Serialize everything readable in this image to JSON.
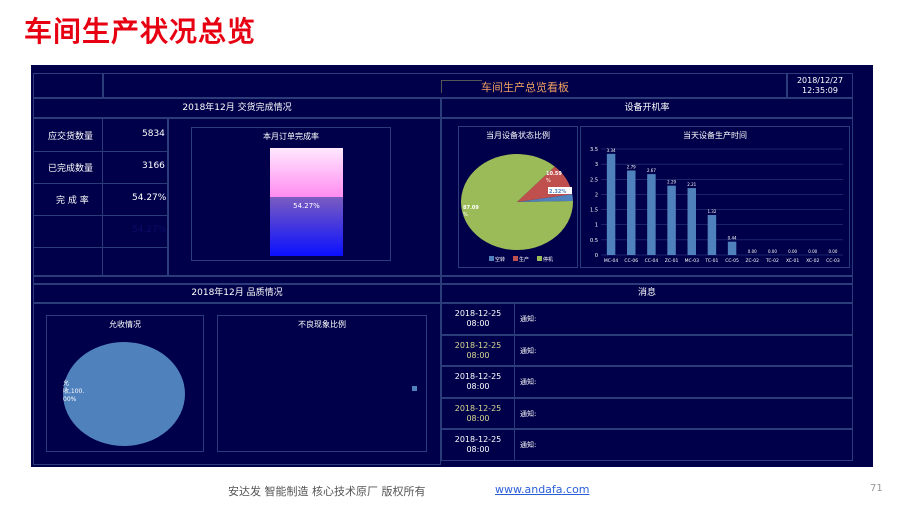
{
  "slide": {
    "title": "车间生产状况总览",
    "page_number": "71"
  },
  "board": {
    "title": "车间生产总览看板",
    "date": "2018/12/27",
    "time": "12:35:09"
  },
  "delivery": {
    "header": "2018年12月 交货完成情况",
    "rows": [
      {
        "label": "应交货数量",
        "value": "5834"
      },
      {
        "label": "已完成数量",
        "value": "3166"
      },
      {
        "label": "完 成 率",
        "value": "54.27%"
      },
      {
        "label": "",
        "value": "54.27%"
      }
    ],
    "order_chart": {
      "title": "本月订单完成率",
      "value_label": "54.27%",
      "fraction": 0.5427
    }
  },
  "equipment": {
    "header": "设备开机率",
    "pie": {
      "title": "当月设备状态比例",
      "slices": [
        {
          "name": "空转",
          "value": 2.32,
          "label": "2.32%",
          "color": "#4f81bd"
        },
        {
          "name": "生产",
          "value": 10.59,
          "label": "10.59 %",
          "color": "#c0504d"
        },
        {
          "name": "停机",
          "value": 87.09,
          "label": "87.09 %",
          "color": "#9bbb59"
        }
      ]
    },
    "bars": {
      "title": "当天设备生产时间",
      "y_ticks": [
        "3.5",
        "3",
        "2.5",
        "2",
        "1.5",
        "1",
        "0.5",
        "0"
      ]
    }
  },
  "chart_data": {
    "type": "bar",
    "title": "当天设备生产时间",
    "categories": [
      "MC-04",
      "CC-06",
      "CC-04",
      "ZC-01",
      "MC-03",
      "TC-01",
      "CC-05",
      "ZC-02",
      "TC-02",
      "XC-01",
      "XC-02",
      "CC-03"
    ],
    "values": [
      3.34,
      2.79,
      2.67,
      2.29,
      2.21,
      1.32,
      0.44,
      0.0,
      0.0,
      0.0,
      0.0,
      0.0
    ],
    "value_labels": [
      "3.34",
      "2.79",
      "2.67",
      "2.29",
      "2.21",
      "1.32",
      "0.44",
      "0.00",
      "0.00",
      "0.00",
      "0.00",
      "0.00"
    ],
    "ylim": [
      0,
      3.5
    ],
    "xlabel": "",
    "ylabel": ""
  },
  "quality": {
    "header": "2018年12月 品质情况",
    "acceptance": {
      "title": "允收情况",
      "label_line1": "允",
      "label_line2": "收,100.",
      "label_line3": "00%"
    },
    "defects": {
      "title": "不良现象比例"
    }
  },
  "messages": {
    "header": "消息",
    "items": [
      {
        "date": "2018-12-25",
        "time": "08:00",
        "text": "通知:"
      },
      {
        "date": "2018-12-25",
        "time": "08:00",
        "text": "通知:"
      },
      {
        "date": "2018-12-25",
        "time": "08:00",
        "text": "通知:"
      },
      {
        "date": "2018-12-25",
        "time": "08:00",
        "text": "通知:"
      },
      {
        "date": "2018-12-25",
        "time": "08:00",
        "text": "通知:"
      }
    ]
  },
  "footer": {
    "text": "安达发   智能制造 核心技术原厂    版权所有",
    "link": "www.andafa.com"
  },
  "colors": {
    "title_red": "#e60012",
    "dash_bg": "#00004a",
    "grid_line": "#2a3c7a",
    "bar": "#4f81bd"
  }
}
